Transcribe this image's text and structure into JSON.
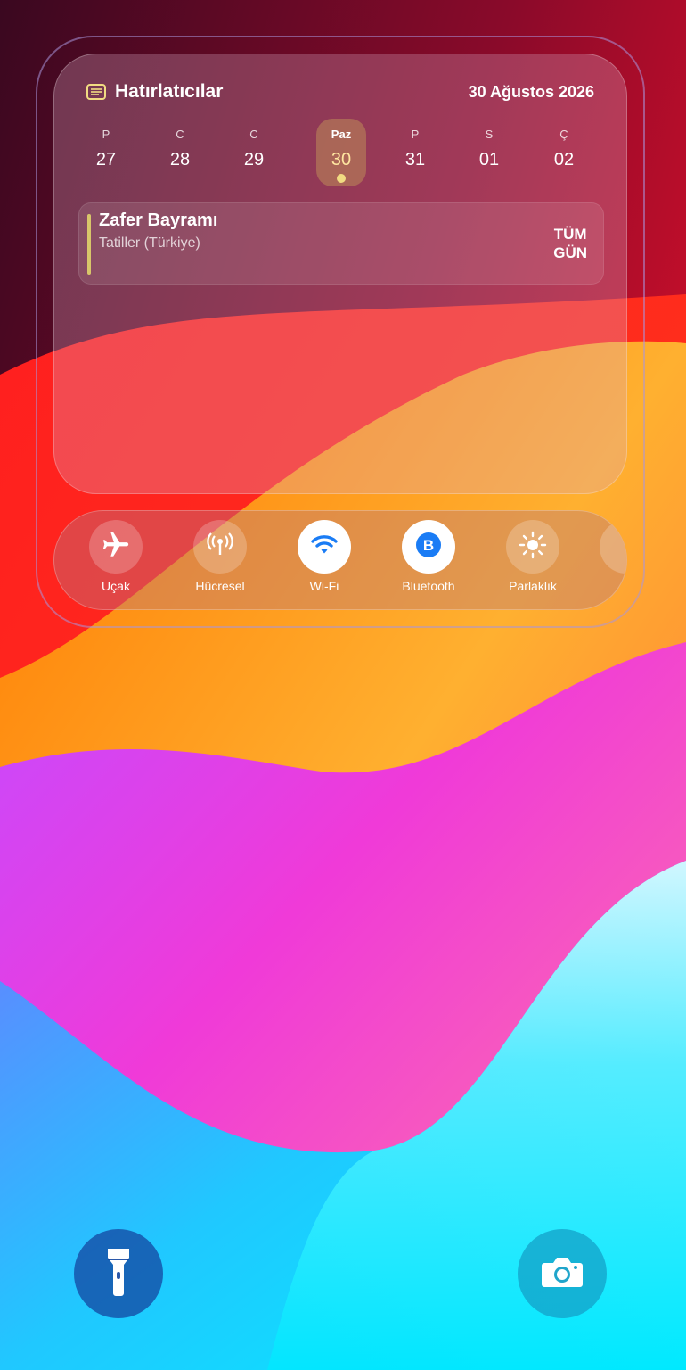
{
  "widget": {
    "title": "Hatırlatıcılar",
    "date": "30 Ağustos 2026",
    "days": [
      {
        "letter": "P",
        "number": "27",
        "selected": false
      },
      {
        "letter": "C",
        "number": "28",
        "selected": false
      },
      {
        "letter": "C",
        "number": "29",
        "selected": false
      },
      {
        "letter": "Paz",
        "number": "30",
        "selected": true
      },
      {
        "letter": "P",
        "number": "31",
        "selected": false
      },
      {
        "letter": "S",
        "number": "01",
        "selected": false
      },
      {
        "letter": "Ç",
        "number": "02",
        "selected": false
      }
    ],
    "event": {
      "title": "Zafer Bayramı",
      "subtitle": "Tatiller (Türkiye)",
      "allday_line1": "TÜM",
      "allday_line2": "GÜN"
    }
  },
  "controls": [
    {
      "label": "Uçak",
      "icon": "airplane-icon",
      "active": false
    },
    {
      "label": "Hücresel",
      "icon": "cellular-icon",
      "active": false
    },
    {
      "label": "Wi-Fi",
      "icon": "wifi-icon",
      "active": true
    },
    {
      "label": "Bluetooth",
      "icon": "bluetooth-icon",
      "active": true
    },
    {
      "label": "Parlaklık",
      "icon": "brightness-icon",
      "active": false
    }
  ],
  "bottom": {
    "flashlight_icon": "flashlight-icon",
    "camera_icon": "camera-icon"
  },
  "colors": {
    "accent_blue": "#1a7cf5",
    "event_bar": "#d8c66a",
    "selected_dot": "#f1dc82"
  }
}
